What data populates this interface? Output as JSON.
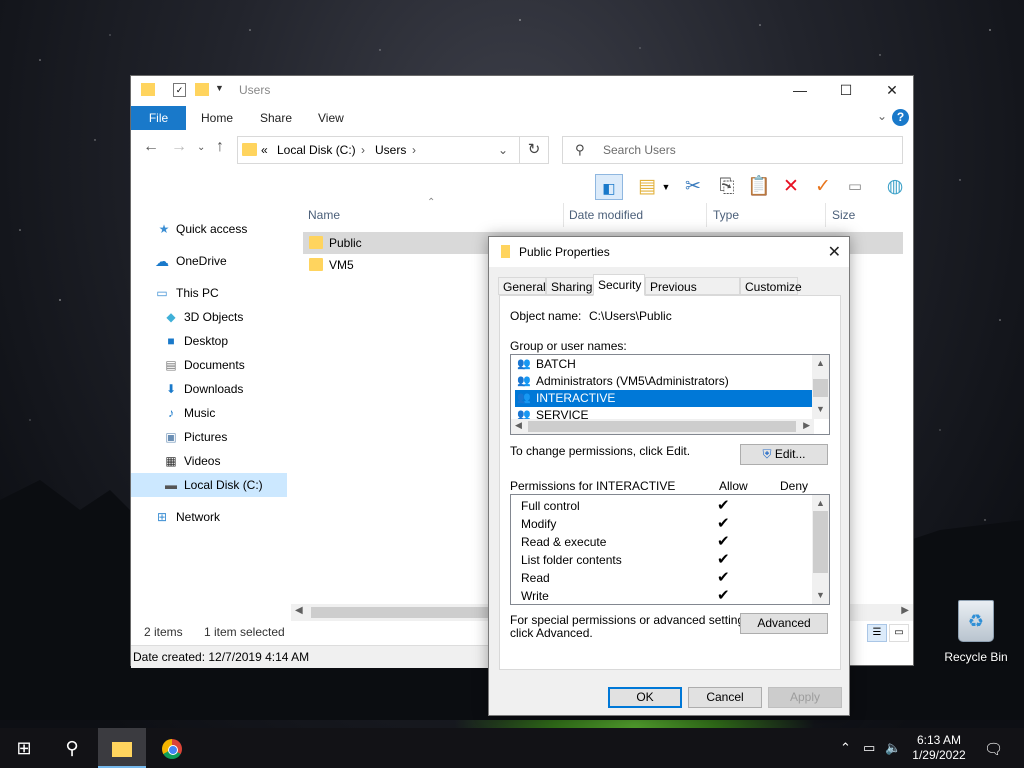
{
  "explorer": {
    "title": "Users",
    "ribbon_tabs": [
      "File",
      "Home",
      "Share",
      "View"
    ],
    "address": {
      "overflow": "«",
      "segments": [
        "Local Disk (C:)",
        "Users"
      ]
    },
    "search_placeholder": "Search Users",
    "columns": [
      "Name",
      "Date modified",
      "Type",
      "Size"
    ],
    "nav": [
      {
        "label": "Quick access",
        "icon": "star-icon"
      },
      {
        "label": "OneDrive",
        "icon": "cloud-icon"
      },
      {
        "label": "This PC",
        "icon": "computer-icon"
      },
      {
        "label": "3D Objects",
        "icon": "cube-icon"
      },
      {
        "label": "Desktop",
        "icon": "desktop-icon"
      },
      {
        "label": "Documents",
        "icon": "document-icon"
      },
      {
        "label": "Downloads",
        "icon": "download-icon"
      },
      {
        "label": "Music",
        "icon": "music-icon"
      },
      {
        "label": "Pictures",
        "icon": "picture-icon"
      },
      {
        "label": "Videos",
        "icon": "video-icon"
      },
      {
        "label": "Local Disk (C:)",
        "icon": "drive-icon",
        "selected": true
      },
      {
        "label": "Network",
        "icon": "network-icon"
      }
    ],
    "files": [
      {
        "name": "Public",
        "selected": true
      },
      {
        "name": "VM5",
        "selected": false
      }
    ],
    "status_items": "2 items",
    "status_selected": "1 item selected",
    "date_created": "Date created: 12/7/2019 4:14 AM"
  },
  "dialog": {
    "title": "Public Properties",
    "tabs": [
      "General",
      "Sharing",
      "Security",
      "Previous Versions",
      "Customize"
    ],
    "active_tab": "Security",
    "object_name_label": "Object name:",
    "object_name_value": "C:\\Users\\Public",
    "group_label": "Group or user names:",
    "users": [
      {
        "name": "BATCH",
        "selected": false
      },
      {
        "name": "Administrators (VM5\\Administrators)",
        "selected": false
      },
      {
        "name": "INTERACTIVE",
        "selected": true
      },
      {
        "name": "SERVICE",
        "selected": false
      }
    ],
    "change_text": "To change permissions, click Edit.",
    "edit_button": "Edit...",
    "permissions_label": "Permissions for INTERACTIVE",
    "allow_header": "Allow",
    "deny_header": "Deny",
    "permissions": [
      {
        "name": "Full control",
        "allow": true,
        "deny": false
      },
      {
        "name": "Modify",
        "allow": true,
        "deny": false
      },
      {
        "name": "Read & execute",
        "allow": true,
        "deny": false
      },
      {
        "name": "List folder contents",
        "allow": true,
        "deny": false
      },
      {
        "name": "Read",
        "allow": true,
        "deny": false
      },
      {
        "name": "Write",
        "allow": true,
        "deny": false
      }
    ],
    "special_text_1": "For special permissions or advanced settings,",
    "special_text_2": "click Advanced.",
    "advanced_button": "Advanced",
    "ok_button": "OK",
    "cancel_button": "Cancel",
    "apply_button": "Apply",
    "check_glyph": "✔"
  },
  "desktop": {
    "recycle_bin": "Recycle Bin"
  },
  "taskbar": {
    "time": "6:13 AM",
    "date": "1/29/2022"
  },
  "colors": {
    "accent": "#0078d7",
    "file_tab": "#1979ca",
    "selection": "#cce8ff",
    "delete_red": "#e81123",
    "check_orange": "#e8761e"
  }
}
